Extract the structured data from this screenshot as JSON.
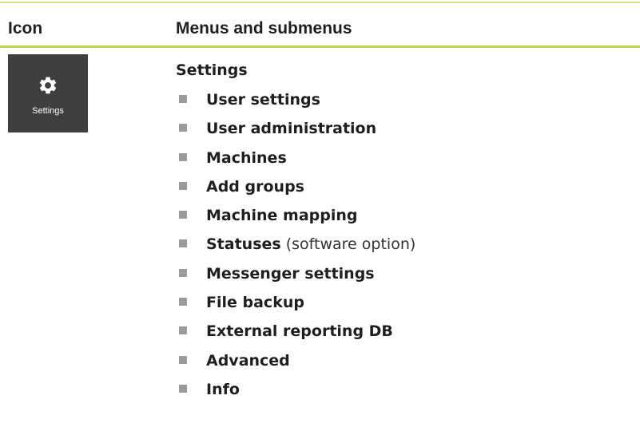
{
  "table": {
    "headers": {
      "icon": "Icon",
      "menus": "Menus and submenus"
    },
    "row": {
      "icon": {
        "name": "gear-icon",
        "caption": "Settings",
        "tile_color": "#3f3f3f"
      },
      "menu_title": "Settings",
      "submenus": [
        {
          "label": "User settings",
          "note": ""
        },
        {
          "label": "User administration",
          "note": ""
        },
        {
          "label": "Machines",
          "note": ""
        },
        {
          "label": "Add groups",
          "note": ""
        },
        {
          "label": "Machine mapping",
          "note": ""
        },
        {
          "label": "Statuses",
          "note": " (software option)"
        },
        {
          "label": "Messenger settings",
          "note": ""
        },
        {
          "label": "File backup",
          "note": ""
        },
        {
          "label": "External reporting DB",
          "note": ""
        },
        {
          "label": "Advanced",
          "note": ""
        },
        {
          "label": "Info",
          "note": ""
        }
      ]
    }
  },
  "colors": {
    "accent_rule": "#c9d34a",
    "bullet": "#9a9a9a"
  }
}
